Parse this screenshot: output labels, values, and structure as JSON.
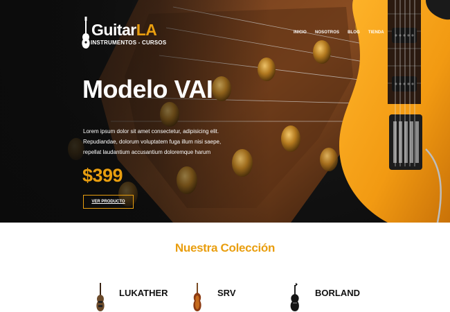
{
  "header": {
    "logo_main": "Guitar",
    "logo_accent": "LA",
    "logo_tagline": "INSTRUMENTOS - CURSOS",
    "nav": [
      "INICIO",
      "NOSOTROS",
      "BLOG",
      "TIENDA"
    ]
  },
  "hero": {
    "title": "Modelo VAI",
    "description": "Lorem ipsum dolor sit amet consectetur, adipisicing elit. Repudiandae, dolorum voluptatem fuga illum nisi saepe, repellat laudantium accusantium doloremque harum",
    "price": "$399",
    "button_label": "VER PRODUCTO"
  },
  "collection": {
    "title": "Nuestra Colección",
    "products": [
      {
        "name": "LUKATHER"
      },
      {
        "name": "SRV"
      },
      {
        "name": "BORLAND"
      }
    ]
  },
  "colors": {
    "accent": "#e99e0f",
    "hero_bg": "#0b0b0b",
    "guitar_body": "#f5a21a",
    "text_dark": "#111111",
    "white": "#ffffff"
  }
}
